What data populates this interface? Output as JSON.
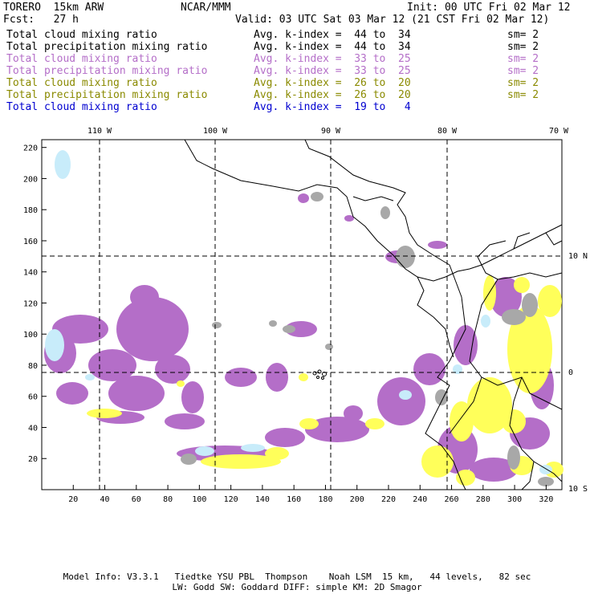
{
  "header": {
    "model": "TORERO  15km ARW",
    "org": "NCAR/MMM",
    "init": "Init: 00 UTC Fri 02 Mar 12",
    "fcst": "Fcst:   27 h",
    "valid": "Valid: 03 UTC Sat 03 Mar 12 (21 CST Fri 02 Mar 12)"
  },
  "legend": [
    {
      "field": "Total cloud mixing ratio",
      "kindex": "Avg. k-index =  44 to  34",
      "sm": "sm= 2",
      "color": "#000000"
    },
    {
      "field": "Total precipitation mixing ratio",
      "kindex": "Avg. k-index =  44 to  34",
      "sm": "sm= 2",
      "color": "#000000"
    },
    {
      "field": "Total cloud mixing ratio",
      "kindex": "Avg. k-index =  33 to  25",
      "sm": "sm= 2",
      "color": "#b46ec8"
    },
    {
      "field": "Total precipitation mixing ratio",
      "kindex": "Avg. k-index =  33 to  25",
      "sm": "sm= 2",
      "color": "#b46ec8"
    },
    {
      "field": "Total cloud mixing ratio",
      "kindex": "Avg. k-index =  26 to  20",
      "sm": "sm= 2",
      "color": "#8a8a00"
    },
    {
      "field": "Total precipitation mixing ratio",
      "kindex": "Avg. k-index =  26 to  20",
      "sm": "sm= 2",
      "color": "#8a8a00"
    },
    {
      "field": "Total cloud mixing ratio",
      "kindex": "Avg. k-index =  19 to   4",
      "sm": "",
      "color": "#0000d0"
    }
  ],
  "map": {
    "lon_labels": [
      "110 W",
      "100 W",
      "90 W",
      "80 W",
      "70 W"
    ],
    "lat_labels": [
      "10 N",
      "0",
      "10 S"
    ],
    "x_ticks": [
      "20",
      "40",
      "60",
      "80",
      "100",
      "120",
      "140",
      "160",
      "180",
      "200",
      "220",
      "240",
      "260",
      "280",
      "300",
      "320"
    ],
    "y_ticks": [
      "20",
      "40",
      "60",
      "80",
      "100",
      "120",
      "140",
      "160",
      "180",
      "200",
      "220"
    ],
    "colors": {
      "purple": "#b46ec8",
      "yellow": "#ffff5a",
      "gray": "#a8a8a8",
      "lightblue": "#c8ecfa"
    }
  },
  "footer": {
    "line1": "Model Info: V3.3.1   Tiedtke YSU PBL  Thompson    Noah LSM  15 km,   44 levels,   82 sec",
    "line2": "LW: Godd SW: Goddard DIFF: simple KM: 2D Smagor"
  }
}
